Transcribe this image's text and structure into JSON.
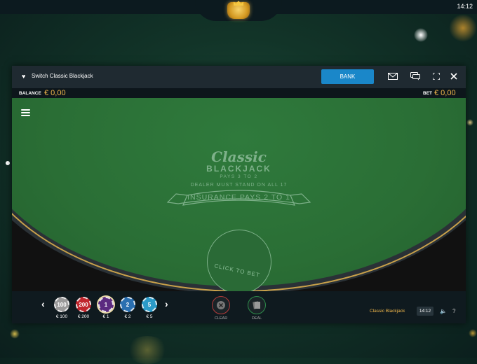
{
  "status": {
    "clock": "14:12"
  },
  "window": {
    "title": "Switch Classic Blackjack",
    "bank_label": "BANK",
    "balance_label": "BALANCE",
    "balance_value": "€ 0,00",
    "bet_label": "BET",
    "bet_value": "€ 0,00"
  },
  "table": {
    "classic": "Classic",
    "blackjack": "BLACKJACK",
    "pays": "PAYS 3 TO 2",
    "dealer_rule": "DEALER MUST STAND ON ALL 17",
    "insurance": "INSURANCE PAYS 2 TO 1",
    "bet_spot": "CLICK TO BET"
  },
  "chips": [
    {
      "value": "100",
      "label": "€ 100",
      "color": "#9a9a9a"
    },
    {
      "value": "200",
      "label": "€ 200",
      "color": "#c0262d"
    },
    {
      "value": "1",
      "label": "€ 1",
      "color": "#5b2a80"
    },
    {
      "value": "2",
      "label": "€ 2",
      "color": "#2a6fb0"
    },
    {
      "value": "5",
      "label": "€ 5",
      "color": "#2b9ac7"
    }
  ],
  "actions": {
    "clear": "CLEAR",
    "deal": "DEAL"
  },
  "footer": {
    "game_name": "Classic Blackjack",
    "time": "14:12"
  },
  "colors": {
    "accent": "#1a87c9",
    "gold": "#f2b84b",
    "felt": "#2a6e35"
  }
}
